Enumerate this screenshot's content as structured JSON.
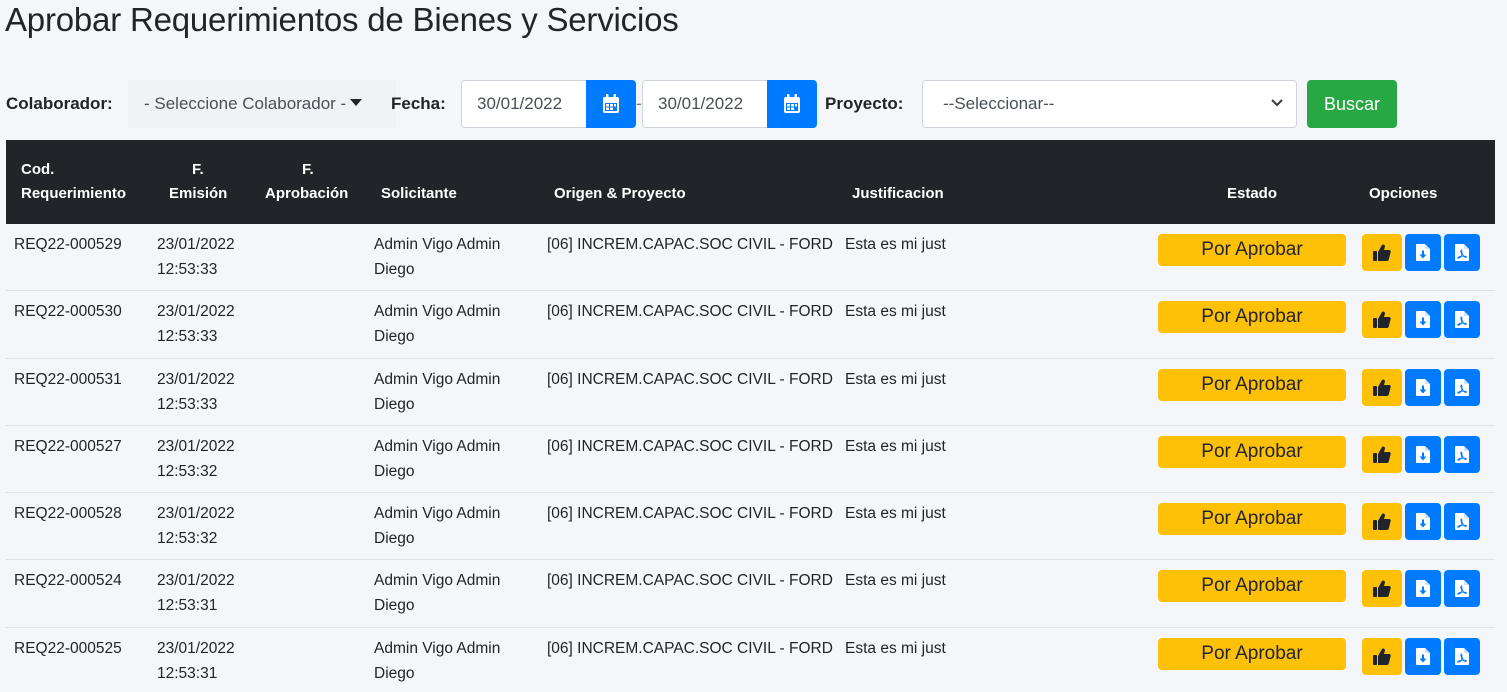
{
  "page": {
    "title": "Aprobar Requerimientos de Bienes y Servicios"
  },
  "filters": {
    "colaborador_label": "Colaborador:",
    "colaborador_value": "- Seleccione Colaborador -",
    "fecha_label": "Fecha:",
    "fecha_desde": "30/01/2022",
    "fecha_separator": "-",
    "fecha_hasta": "30/01/2022",
    "proyecto_label": "Proyecto:",
    "proyecto_value": "--Seleccionar--",
    "buscar_label": "Buscar"
  },
  "table": {
    "headers": {
      "cod_line1": "Cod.",
      "cod_line2": "Requerimiento",
      "emision_line1": "F.",
      "emision_line2": "Emisión",
      "aprobacion_line1": "F.",
      "aprobacion_line2": "Aprobación",
      "solicitante": "Solicitante",
      "origen": "Origen & Proyecto",
      "justificacion": "Justificacion",
      "estado": "Estado",
      "opciones": "Opciones"
    },
    "rows": [
      {
        "cod": "REQ22-000529",
        "fecha": "23/01/2022",
        "hora": "12:53:33",
        "aprobacion": "",
        "solicitante_1": "Admin Vigo Admin",
        "solicitante_2": "Diego",
        "origen": "[06] INCREM.CAPAC.SOC CIVIL - FORD",
        "justificacion": "Esta es mi just",
        "estado": "Por Aprobar"
      },
      {
        "cod": "REQ22-000530",
        "fecha": "23/01/2022",
        "hora": "12:53:33",
        "aprobacion": "",
        "solicitante_1": "Admin Vigo Admin",
        "solicitante_2": "Diego",
        "origen": "[06] INCREM.CAPAC.SOC CIVIL - FORD",
        "justificacion": "Esta es mi just",
        "estado": "Por Aprobar"
      },
      {
        "cod": "REQ22-000531",
        "fecha": "23/01/2022",
        "hora": "12:53:33",
        "aprobacion": "",
        "solicitante_1": "Admin Vigo Admin",
        "solicitante_2": "Diego",
        "origen": "[06] INCREM.CAPAC.SOC CIVIL - FORD",
        "justificacion": "Esta es mi just",
        "estado": "Por Aprobar"
      },
      {
        "cod": "REQ22-000527",
        "fecha": "23/01/2022",
        "hora": "12:53:32",
        "aprobacion": "",
        "solicitante_1": "Admin Vigo Admin",
        "solicitante_2": "Diego",
        "origen": "[06] INCREM.CAPAC.SOC CIVIL - FORD",
        "justificacion": "Esta es mi just",
        "estado": "Por Aprobar"
      },
      {
        "cod": "REQ22-000528",
        "fecha": "23/01/2022",
        "hora": "12:53:32",
        "aprobacion": "",
        "solicitante_1": "Admin Vigo Admin",
        "solicitante_2": "Diego",
        "origen": "[06] INCREM.CAPAC.SOC CIVIL - FORD",
        "justificacion": "Esta es mi just",
        "estado": "Por Aprobar"
      },
      {
        "cod": "REQ22-000524",
        "fecha": "23/01/2022",
        "hora": "12:53:31",
        "aprobacion": "",
        "solicitante_1": "Admin Vigo Admin",
        "solicitante_2": "Diego",
        "origen": "[06] INCREM.CAPAC.SOC CIVIL - FORD",
        "justificacion": "Esta es mi just",
        "estado": "Por Aprobar"
      },
      {
        "cod": "REQ22-000525",
        "fecha": "23/01/2022",
        "hora": "12:53:31",
        "aprobacion": "",
        "solicitante_1": "Admin Vigo Admin",
        "solicitante_2": "Diego",
        "origen": "[06] INCREM.CAPAC.SOC CIVIL - FORD",
        "justificacion": "Esta es mi just",
        "estado": "Por Aprobar"
      }
    ]
  },
  "icons": {
    "calendar": "calendar-icon",
    "approve": "thumbs-up-icon",
    "download": "file-download-icon",
    "pdf": "file-pdf-icon",
    "caret": "caret-down-icon",
    "select_chevron": "chevron-down-icon"
  },
  "colors": {
    "primary": "#007bff",
    "success": "#28a745",
    "warning": "#ffc107",
    "table_header": "#212529",
    "background": "#f4f6f9"
  }
}
